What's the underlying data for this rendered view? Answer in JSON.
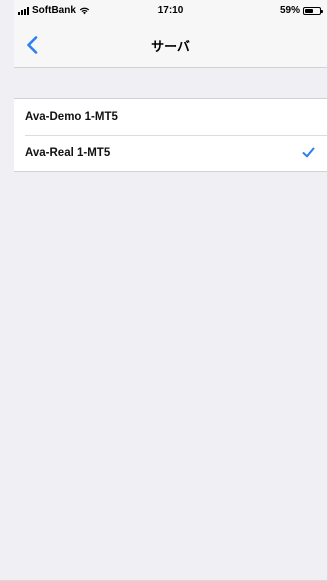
{
  "status_bar": {
    "carrier": "SoftBank",
    "time": "17:10",
    "battery_percent": "59%",
    "battery_level": 0.59
  },
  "nav": {
    "back_icon": "chevron-left-icon",
    "title": "サーバ"
  },
  "servers": [
    {
      "label": "Ava-Demo 1-MT5",
      "selected": false
    },
    {
      "label": "Ava-Real 1-MT5",
      "selected": true
    }
  ],
  "colors": {
    "accent": "#2a7ff2",
    "background": "#efeff4",
    "bar": "#f7f7f8"
  }
}
